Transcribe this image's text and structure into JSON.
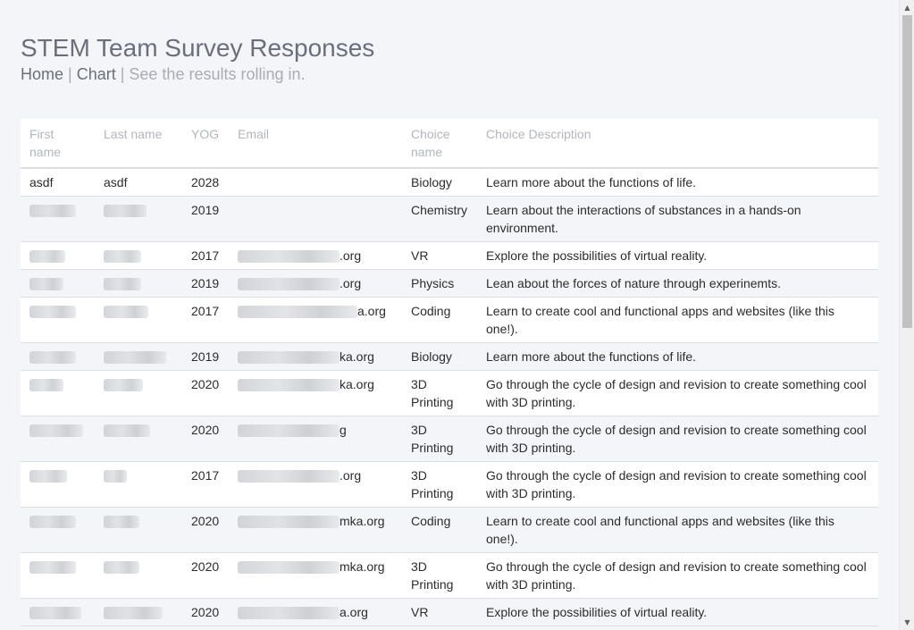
{
  "header": {
    "title": "STEM Team Survey Responses",
    "nav_home": "Home",
    "nav_sep1": " | ",
    "nav_chart": "Chart",
    "nav_sep2": " | ",
    "tagline": "See the results rolling in."
  },
  "table": {
    "columns": {
      "first": "First name",
      "last": "Last name",
      "yog": "YOG",
      "email": "Email",
      "choice": "Choice name",
      "desc": "Choice Description"
    },
    "rows": [
      {
        "first": "asdf",
        "last": "asdf",
        "yog": "2028",
        "email_suffix": "",
        "choice": "Biology",
        "desc": "Learn more about the functions of life.",
        "redacted": false
      },
      {
        "first": "",
        "last": "",
        "yog": "2019",
        "email_suffix": "",
        "choice": "Chemistry",
        "desc": "Learn about the interactions of substances in a hands-on environment.",
        "redacted": true
      },
      {
        "first": "",
        "last": "",
        "yog": "2017",
        "email_suffix": ".org",
        "choice": "VR",
        "desc": "Explore the possibilities of virtual reality.",
        "redacted": true
      },
      {
        "first": "",
        "last": "",
        "yog": "2019",
        "email_suffix": ".org",
        "choice": "Physics",
        "desc": "Lean about the forces of nature through experinemts.",
        "redacted": true
      },
      {
        "first": "",
        "last": "",
        "yog": "2017",
        "email_suffix": "a.org",
        "choice": "Coding",
        "desc": "Learn to create cool and functional apps and websites (like this one!).",
        "redacted": true
      },
      {
        "first": "",
        "last": "",
        "yog": "2019",
        "email_suffix": "ka.org",
        "choice": "Biology",
        "desc": "Learn more about the functions of life.",
        "redacted": true
      },
      {
        "first": "",
        "last": "",
        "yog": "2020",
        "email_suffix": "ka.org",
        "choice": "3D Printing",
        "desc": "Go through the cycle of design and revision to create something cool with 3D printing.",
        "redacted": true
      },
      {
        "first": "",
        "last": "",
        "yog": "2020",
        "email_suffix": "g",
        "choice": "3D Printing",
        "desc": "Go through the cycle of design and revision to create something cool with 3D printing.",
        "redacted": true
      },
      {
        "first": "",
        "last": "",
        "yog": "2017",
        "email_suffix": ".org",
        "choice": "3D Printing",
        "desc": "Go through the cycle of design and revision to create something cool with 3D printing.",
        "redacted": true
      },
      {
        "first": "",
        "last": "",
        "yog": "2020",
        "email_suffix": "mka.org",
        "choice": "Coding",
        "desc": "Learn to create cool and functional apps and websites (like this one!).",
        "redacted": true
      },
      {
        "first": "",
        "last": "",
        "yog": "2020",
        "email_suffix": "mka.org",
        "choice": "3D Printing",
        "desc": "Go through the cycle of design and revision to create something cool with 3D printing.",
        "redacted": true
      },
      {
        "first": "",
        "last": "",
        "yog": "2020",
        "email_suffix": "a.org",
        "choice": "VR",
        "desc": "Explore the possibilities of virtual reality.",
        "redacted": true
      }
    ]
  },
  "scrollbar": {
    "up_glyph": "▲",
    "down_glyph": "▼"
  }
}
